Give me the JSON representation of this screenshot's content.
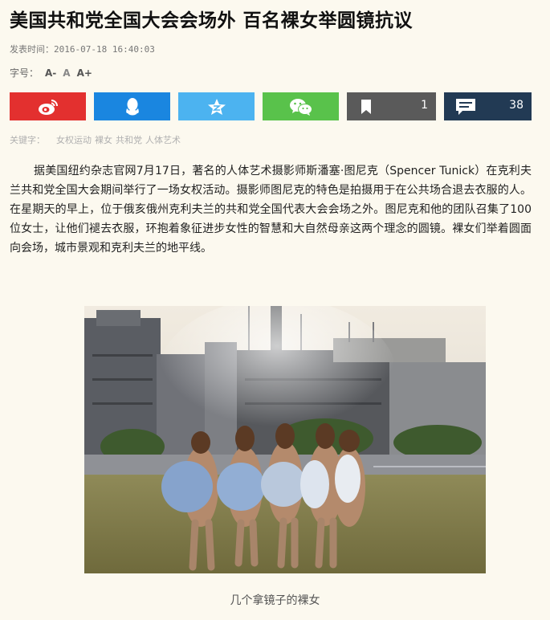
{
  "article": {
    "title": "美国共和党全国大会会场外 百名裸女举圆镜抗议",
    "published_label": "发表时间：",
    "published_time": "2016-07-18 16:40:03",
    "fontsize_label": "字号：",
    "fontsize_smaller": "A-",
    "fontsize_default": "A",
    "fontsize_larger": "A+",
    "body": "据美国纽约杂志官网7月17日，著名的人体艺术摄影师斯潘塞·图尼克（Spencer Tunick）在克利夫兰共和党全国大会期间举行了一场女权活动。摄影师图尼克的特色是拍摄用于在公共场合退去衣服的人。在星期天的早上，位于俄亥俄州克利夫兰的共和党全国代表大会会场之外。图尼克和他的团队召集了100位女士，让他们褪去衣服，环抱着象征进步女性的智慧和大自然母亲这两个理念的圆镜。裸女们举着圆面向会场，城市景观和克利夫兰的地平线。",
    "caption": "几个拿镜子的裸女"
  },
  "share": {
    "bookmark_count": "1",
    "comment_count": "38"
  },
  "keywords": {
    "label": "关键字：",
    "items": [
      "女权运动",
      "裸女",
      "共和党",
      "人体艺术"
    ]
  },
  "colors": {
    "weibo": "#e3302f",
    "qq": "#1a86e0",
    "qzone": "#4cb3f0",
    "wechat": "#59c24b",
    "bookmark": "#5a5a5a",
    "comment": "#223a54"
  },
  "icons": {
    "weibo": "weibo-icon",
    "qq": "qq-icon",
    "qzone": "qzone-star-icon",
    "wechat": "wechat-icon",
    "bookmark": "bookmark-icon",
    "comment": "comment-icon"
  }
}
